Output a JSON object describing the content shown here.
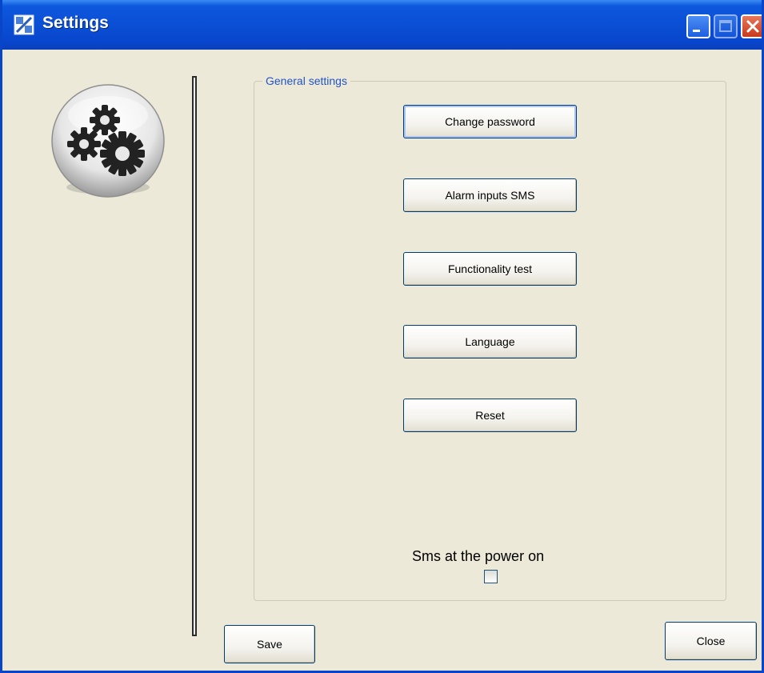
{
  "window": {
    "title": "Settings",
    "icons": {
      "app": "settings-app-icon",
      "minimize": "minimize-icon",
      "maximize": "maximize-icon",
      "close": "close-icon"
    }
  },
  "logo": {
    "icon": "gears-icon"
  },
  "general_settings": {
    "legend": "General settings",
    "buttons": [
      {
        "label": "Change password"
      },
      {
        "label": "Alarm inputs SMS"
      },
      {
        "label": "Functionality test"
      },
      {
        "label": "Language"
      },
      {
        "label": "Reset"
      }
    ],
    "sms_power_on": {
      "label": "Sms at the power on",
      "checked": false
    }
  },
  "footer": {
    "save_label": "Save",
    "close_label": "Close"
  },
  "colors": {
    "titlebar": "#0a4fd5",
    "window_bg": "#ece9d8",
    "legend_text": "#2254c4",
    "close_button": "#c8391c"
  }
}
